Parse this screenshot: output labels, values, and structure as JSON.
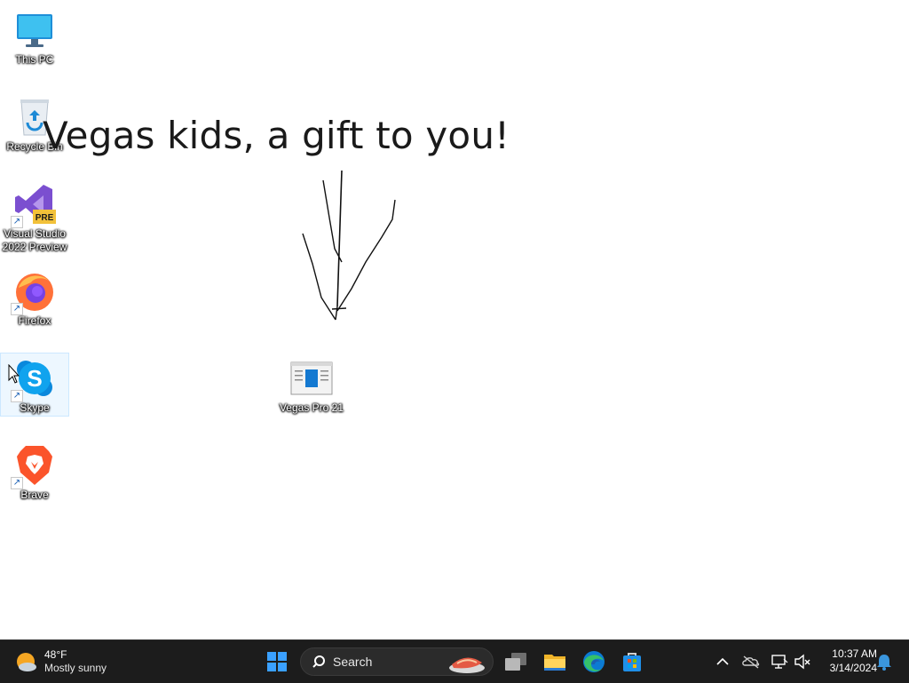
{
  "desktop": {
    "icons": [
      {
        "label": "This PC"
      },
      {
        "label": "Recycle Bin"
      },
      {
        "label": "Visual Studio 2022 Preview",
        "badge": "PRE"
      },
      {
        "label": "Firefox"
      },
      {
        "label": "Skype"
      },
      {
        "label": "Brave"
      },
      {
        "label": "Vegas Pro 21"
      }
    ],
    "wallpaper_text": "Vegas kids, a gift to you!"
  },
  "taskbar": {
    "weather": {
      "temp": "48°F",
      "condition": "Mostly sunny"
    },
    "search": {
      "label": "Search"
    },
    "clock": {
      "time": "10:37 AM",
      "date": "3/14/2024"
    },
    "pinned": [
      "start-icon",
      "search-icon",
      "task-view-icon",
      "file-explorer-icon",
      "edge-icon",
      "microsoft-store-icon"
    ],
    "tray": [
      "chevron-up-icon",
      "onedrive-icon",
      "network-icon",
      "volume-muted-icon",
      "notification-bell-icon"
    ]
  },
  "colors": {
    "taskbar_bg": "#1c1c1c",
    "start_blue": "#0078d4",
    "notification_blue": "#3a96dd"
  }
}
